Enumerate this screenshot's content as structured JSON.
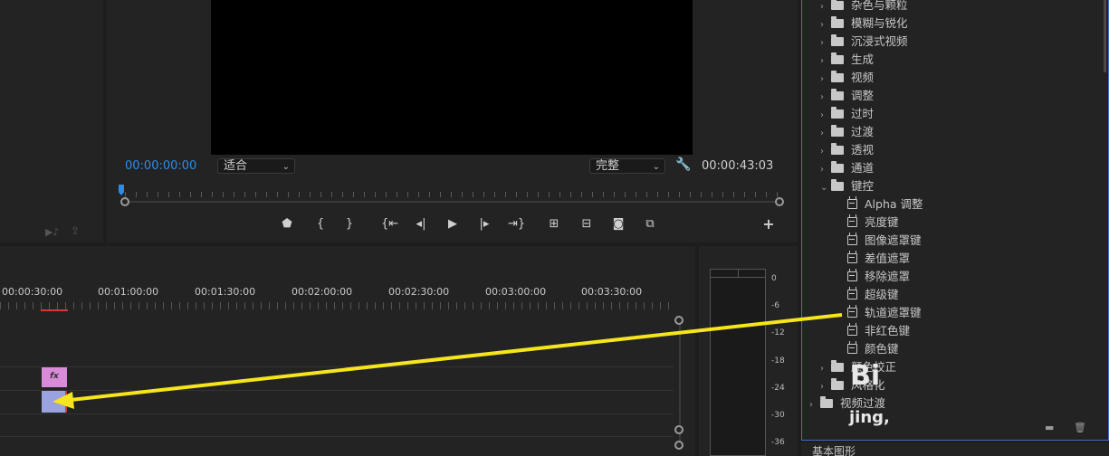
{
  "program_monitor": {
    "current_timecode": "00:00:00:00",
    "duration_timecode": "00:00:43:03",
    "zoom_select": "适合",
    "quality_select": "完整"
  },
  "timeline": {
    "time_labels": [
      "00:00:30:00",
      "00:01:00:00",
      "00:01:30:00",
      "00:02:00:00",
      "00:02:30:00",
      "00:03:00:00",
      "00:03:30:00"
    ],
    "clip_fx_badge": "fx"
  },
  "audio_meter": {
    "db_labels": [
      "0",
      "-6",
      "-12",
      "-18",
      "-24",
      "-30",
      "-36"
    ]
  },
  "effects_panel": {
    "items": [
      {
        "type": "folder",
        "label": "杂色与颗粒",
        "expanded": false
      },
      {
        "type": "folder",
        "label": "模糊与锐化",
        "expanded": false
      },
      {
        "type": "folder",
        "label": "沉浸式视频",
        "expanded": false
      },
      {
        "type": "folder",
        "label": "生成",
        "expanded": false
      },
      {
        "type": "folder",
        "label": "视频",
        "expanded": false
      },
      {
        "type": "folder",
        "label": "调整",
        "expanded": false
      },
      {
        "type": "folder",
        "label": "过时",
        "expanded": false
      },
      {
        "type": "folder",
        "label": "过渡",
        "expanded": false
      },
      {
        "type": "folder",
        "label": "透视",
        "expanded": false
      },
      {
        "type": "folder",
        "label": "通道",
        "expanded": false
      },
      {
        "type": "folder",
        "label": "键控",
        "expanded": true
      },
      {
        "type": "effect",
        "label": "Alpha 调整"
      },
      {
        "type": "effect",
        "label": "亮度键"
      },
      {
        "type": "effect",
        "label": "图像遮罩键"
      },
      {
        "type": "effect",
        "label": "差值遮罩"
      },
      {
        "type": "effect",
        "label": "移除遮罩"
      },
      {
        "type": "effect",
        "label": "超级键"
      },
      {
        "type": "effect",
        "label": "轨道遮罩键"
      },
      {
        "type": "effect",
        "label": "非红色键"
      },
      {
        "type": "effect",
        "label": "颜色键"
      },
      {
        "type": "folder",
        "label": "颜色校正",
        "expanded": false
      },
      {
        "type": "folder",
        "label": "风格化",
        "expanded": false
      }
    ],
    "root_folder": "视频过渡"
  },
  "watermark": {
    "line1": "Bi",
    "line2": "jing,"
  },
  "bottom_tab": "基本图形",
  "colors": {
    "timecode_blue": "#2d8ceb",
    "arrow_yellow": "#f6e51c",
    "clip_pink": "#d98ad8",
    "clip_purple": "#9aa2e0",
    "focus_border": "#3d6fbd"
  }
}
